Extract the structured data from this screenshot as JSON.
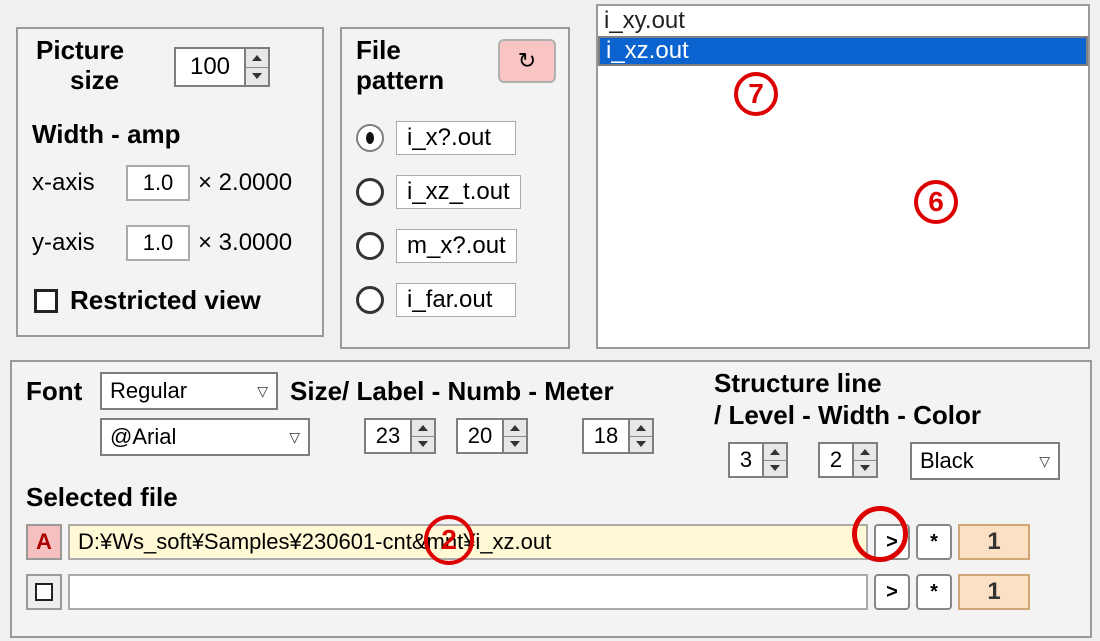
{
  "picture": {
    "label_picture": "Picture",
    "label_size": "size",
    "size_value": "100",
    "width_amp_label": "Width - amp",
    "x_axis_label": "x-axis",
    "x_axis_value": "1.0",
    "x_axis_mult": "× 2.0000",
    "y_axis_label": "y-axis",
    "y_axis_value": "1.0",
    "y_axis_mult": "× 3.0000",
    "restricted_label": "Restricted view",
    "restricted_checked": false
  },
  "pattern": {
    "label_file": "File",
    "label_pattern": "pattern",
    "refresh_icon": "↻",
    "options": [
      "i_x?.out",
      "i_xz_t.out",
      "m_x?.out",
      "i_far.out"
    ],
    "selected_index": 0
  },
  "file_list": {
    "items": [
      "i_xy.out",
      "i_xz.out"
    ],
    "selected_index": 1
  },
  "font": {
    "label": "Font",
    "style": "Regular",
    "family": "@Arial"
  },
  "sizes": {
    "label": "Size/ Label - Numb - Meter",
    "label_val": "23",
    "numb_val": "20",
    "meter_val": "18"
  },
  "structure": {
    "line1": "Structure line",
    "line2": "/ Level - Width - Color",
    "level": "3",
    "width": "2",
    "color": "Black"
  },
  "selected_file": {
    "label": "Selected file",
    "rows": [
      {
        "handle": "A",
        "highlight": true,
        "path": "D:¥Ws_soft¥Samples¥230601-cnt&mnt¥i_xz.out",
        "count": "1"
      },
      {
        "handle": "",
        "highlight": false,
        "path": "",
        "count": "1"
      }
    ],
    "btn_gt": ">",
    "btn_star": "*"
  },
  "annotations": {
    "a7": "7",
    "a6": "6",
    "a2": "2"
  }
}
